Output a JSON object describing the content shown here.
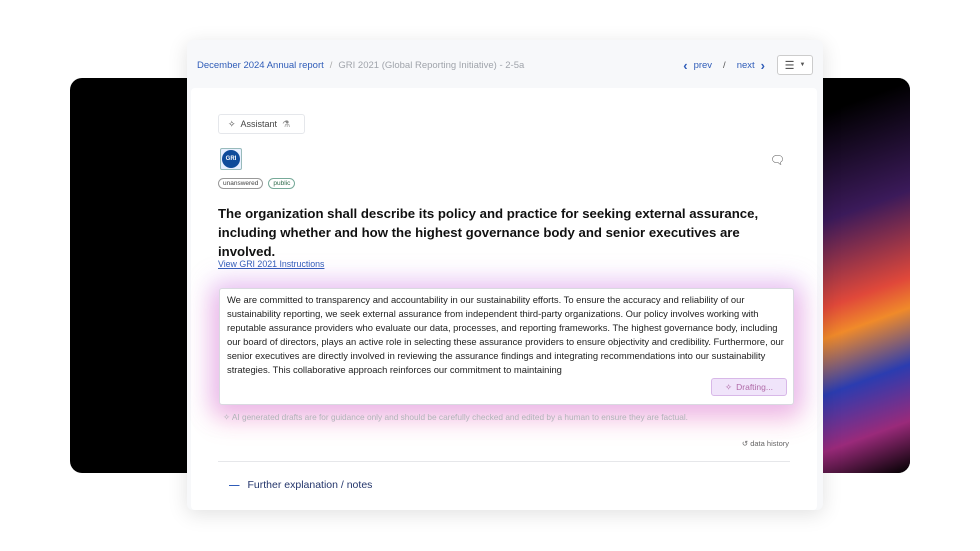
{
  "breadcrumb": {
    "report": "December 2024 Annual report",
    "section": "GRI 2021 (Global Reporting Initiative) - 2-5a"
  },
  "nav": {
    "prev": "prev",
    "separator": "/",
    "next": "next"
  },
  "assistant": {
    "label": "Assistant"
  },
  "logo": {
    "text": "GRI"
  },
  "tags": [
    "unanswered",
    "public"
  ],
  "question": "The organization shall describe its policy and practice for seeking external assurance, including whether and how the highest governance body and senior executives are involved.",
  "instructions_link": "View GRI 2021 Instructions",
  "answer": "We are committed to transparency and accountability in our sustainability efforts. To ensure the accuracy and reliability of our sustainability reporting, we seek external assurance from independent third-party organizations. Our policy involves working with reputable assurance providers who evaluate our data, processes, and reporting frameworks. The highest governance body, including our board of directors, plays an active role in selecting these assurance providers to ensure objectivity and credibility. Furthermore, our senior executives are directly involved in reviewing the assurance findings and integrating recommendations into our sustainability strategies. This collaborative approach reinforces our commitment to maintaining",
  "draft_button": "Drafting...",
  "disclaimer": "AI generated drafts are for guidance only and should be carefully checked and edited by a human to ensure they are factual.",
  "data_history": "data history",
  "further": "Further explanation / notes"
}
